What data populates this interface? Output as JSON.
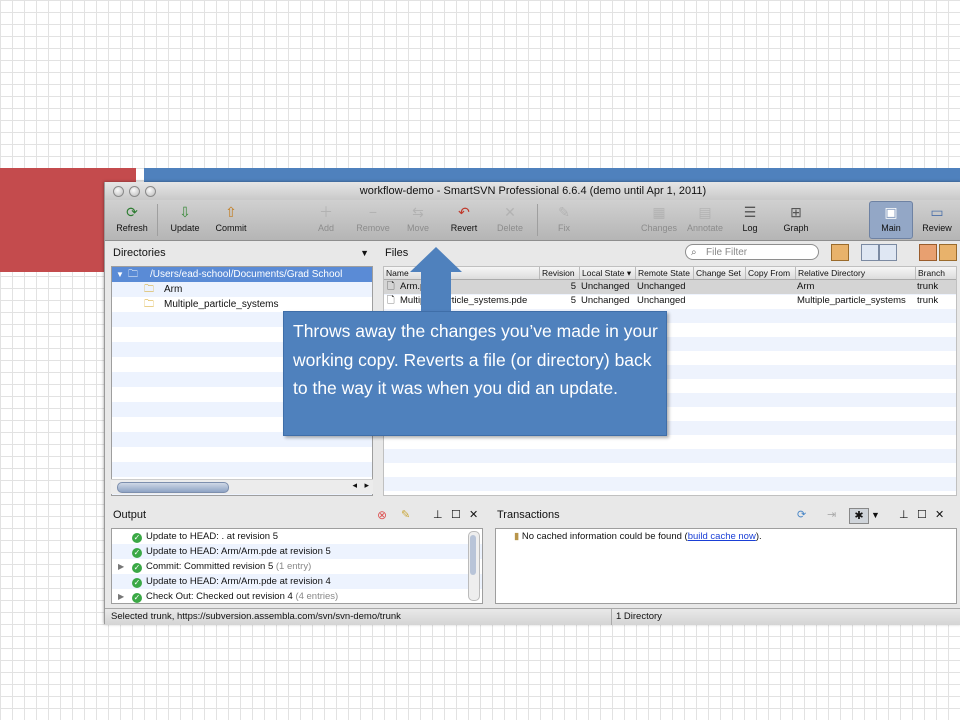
{
  "window": {
    "title": "workflow-demo - SmartSVN Professional 6.6.4 (demo until Apr 1, 2011)"
  },
  "toolbar": {
    "refresh": "Refresh",
    "update": "Update",
    "commit": "Commit",
    "add": "Add",
    "remove": "Remove",
    "move": "Move",
    "revert": "Revert",
    "delete": "Delete",
    "fix": "Fix",
    "changes": "Changes",
    "annotate": "Annotate",
    "log": "Log",
    "graph": "Graph",
    "main": "Main",
    "review": "Review"
  },
  "directories": {
    "title": "Directories",
    "items": [
      "/Users/ead-school/Documents/Grad School",
      "Arm",
      "Multiple_particle_systems"
    ]
  },
  "files": {
    "title": "Files",
    "filter_placeholder": "File Filter",
    "columns": [
      "Name",
      "Revision",
      "Local State ▾",
      "Remote State",
      "Change Set",
      "Copy From",
      "Relative Directory",
      "Branch"
    ],
    "rows": [
      {
        "name": "Arm.pde",
        "revision": "5",
        "local": "Unchanged",
        "remote": "Unchanged",
        "changeset": "",
        "copyfrom": "",
        "reldir": "Arm",
        "branch": "trunk"
      },
      {
        "name": "Multiple_particle_systems.pde",
        "revision": "5",
        "local": "Unchanged",
        "remote": "Unchanged",
        "changeset": "",
        "copyfrom": "",
        "reldir": "Multiple_particle_systems",
        "branch": "trunk"
      }
    ]
  },
  "output": {
    "title": "Output",
    "items": [
      {
        "text": "Update to HEAD: . at revision 5",
        "extra": "",
        "expandable": false
      },
      {
        "text": "Update to HEAD: Arm/Arm.pde at revision 5",
        "extra": "",
        "expandable": false
      },
      {
        "text": "Commit: Committed revision 5",
        "extra": "(1 entry)",
        "expandable": true
      },
      {
        "text": "Update to HEAD: Arm/Arm.pde at revision 4",
        "extra": "",
        "expandable": false
      },
      {
        "text": "Check Out: Checked out revision 4",
        "extra": "(4 entries)",
        "expandable": true
      }
    ]
  },
  "transactions": {
    "title": "Transactions",
    "message": "No cached information could be found (",
    "link": "build cache now",
    "message_end": ")."
  },
  "status": {
    "left": "Selected trunk, https://subversion.assembla.com/svn/svn-demo/trunk",
    "right": "1 Directory"
  },
  "callout": {
    "text": "Throws away the changes you’ve made in your working copy. Reverts a file (or directory) back to the way it was when you did an update."
  },
  "colors": {
    "accent_blue": "#4f81bd",
    "accent_red": "#c44b4d",
    "selection": "#5a8bd6"
  }
}
